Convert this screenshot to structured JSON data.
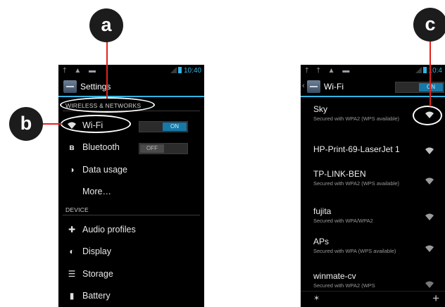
{
  "callouts": {
    "a": "a",
    "b": "b",
    "c": "c"
  },
  "phone1": {
    "status": {
      "left_icons": "† ▲ ▬",
      "time": "10:40"
    },
    "title": "Settings",
    "section_wireless": "WIRELESS & NETWORKS",
    "rows_wireless": [
      {
        "label": "Wi-Fi",
        "icon": "wifi-icon",
        "toggle": "ON"
      },
      {
        "label": "Bluetooth",
        "icon": "bluetooth-icon",
        "toggle": "OFF"
      },
      {
        "label": "Data usage",
        "icon": "data-usage-icon"
      },
      {
        "label": "More…"
      }
    ],
    "section_device": "DEVICE",
    "rows_device": [
      {
        "label": "Audio profiles",
        "icon": "audio-profiles-icon"
      },
      {
        "label": "Display",
        "icon": "display-icon"
      },
      {
        "label": "Storage",
        "icon": "storage-icon"
      },
      {
        "label": "Battery",
        "icon": "battery-icon"
      }
    ]
  },
  "phone2": {
    "status": {
      "left_icons": "† † ▲ ▬",
      "time": "10:4"
    },
    "back": "‹",
    "title": "Wi-Fi",
    "toggle": "ON",
    "networks": [
      {
        "name": "Sky",
        "detail": "Secured with WPA2 (WPS available)"
      },
      {
        "name": "HP-Print-69-LaserJet 1",
        "detail": ""
      },
      {
        "name": "TP-LINK-BEN",
        "detail": "Secured with WPA2 (WPS available)"
      },
      {
        "name": "fujita",
        "detail": "Secured with WPA/WPA2"
      },
      {
        "name": "APs",
        "detail": "Secured with WPA (WPS available)"
      },
      {
        "name": "winmate-cv",
        "detail": "Secured with WPA2 (WPS"
      }
    ],
    "bottom_left": "✶",
    "bottom_right": "+"
  },
  "colors": {
    "accent": "#33b5e5",
    "toggle_on": "#1679a8",
    "callout_line": "#e2231a"
  }
}
